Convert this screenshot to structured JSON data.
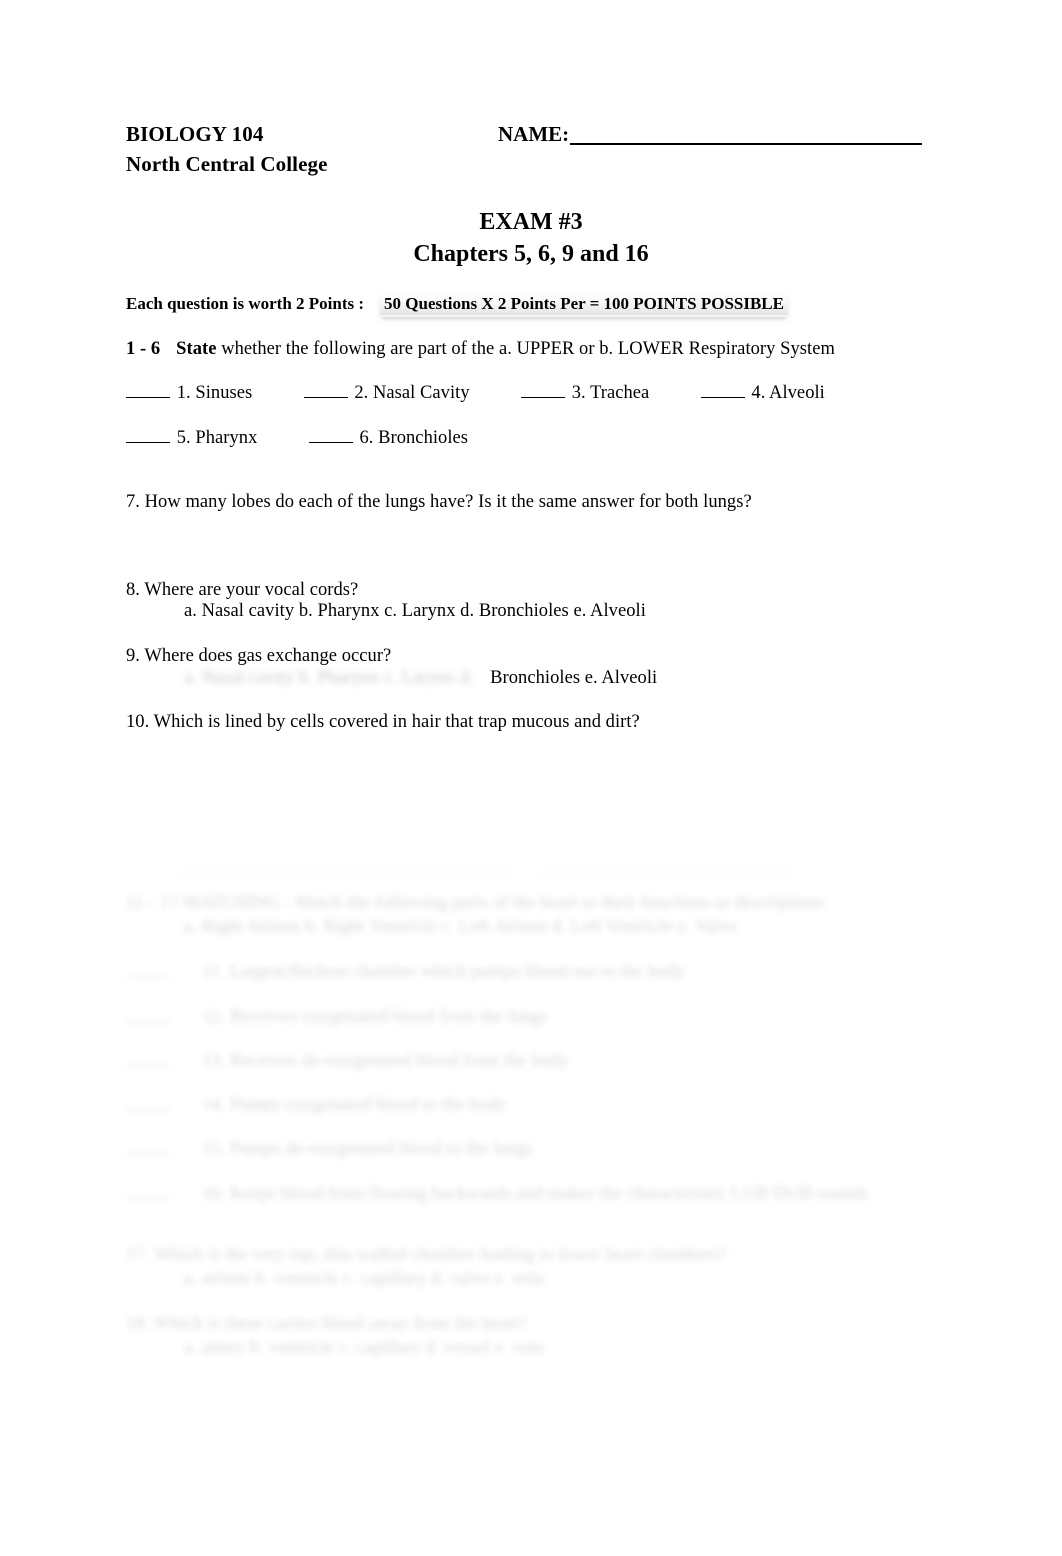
{
  "document": {
    "course": "BIOLOGY 104",
    "institution": "North Central College",
    "name_label": "NAME:",
    "exam_title": "EXAM #3",
    "exam_subtitle": "Chapters 5, 6, 9 and 16"
  },
  "points": {
    "prefix": "Each question is worth 2 Points :",
    "highlight": "50 Questions X 2 Points Per = 100 POINTS POSSIBLE"
  },
  "instruction": {
    "range": "1 - 6",
    "verb": "State",
    "text": "whether the following are part of the  a.  UPPER  or   b.  LOWER  Respiratory System"
  },
  "matching": {
    "row1": [
      {
        "num": "1.",
        "label": "Sinuses"
      },
      {
        "num": "2.",
        "label": "Nasal Cavity"
      },
      {
        "num": "3.",
        "label": "Trachea"
      },
      {
        "num": "4.",
        "label": "Alveoli"
      }
    ],
    "row2": [
      {
        "num": "5.",
        "label": "Pharynx"
      },
      {
        "num": "6.",
        "label": "Bronchioles"
      }
    ]
  },
  "questions": {
    "q7": "7.  How many lobes do each of the lungs have?  Is it the same answer for both lungs?",
    "q8": "8.  Where are your vocal cords?",
    "q8_options": "a.  Nasal cavity     b.  Pharynx     c.  Larynx     d.  Bronchioles        e.  Alveoli",
    "q9": "9.  Where does gas exchange occur?",
    "q9_options_blurred": "a.  Nasal cavity     b.  Pharynx     c.  Larynx     d.",
    "q9_options_visible": "Bronchioles        e.  Alveoli",
    "q10": "10.  Which is lined by cells covered in hair that trap mucous and dirt?"
  },
  "faded_section": {
    "note": "lower portion of page is blurred and illegible",
    "lines": [
      "11 - 17  MATCHING :  Match the following parts of the heart to their functions or descriptions",
      "a.  Right Atrium        b.  Right Ventricle        c.  Left Atrium        d.  Left Ventricle        e.  Valve",
      "11.  Largest/thickest chamber which pumps blood out to the body",
      "12.  Receives oxygenated blood from the lungs",
      "13.  Receives de-oxygenated blood from the body",
      "14.  Pumps oxygenated blood to the body",
      "15.  Pumps de-oxygenated blood to the lungs",
      "16.  Keeps blood from flowing backwards and makes the characteristic LUB DUB sounds",
      "17.  Which is the very top, thin walled chamber leading to lower heart chambers?",
      "a.  atrium       b.  ventricle       c.  capillary       d.  valve       e.  vein",
      "18.  Which is these carries blood away from the heart?",
      "a.  artery       b.  ventricle       c.  capillary       d.  vessel       e.  vein"
    ]
  }
}
